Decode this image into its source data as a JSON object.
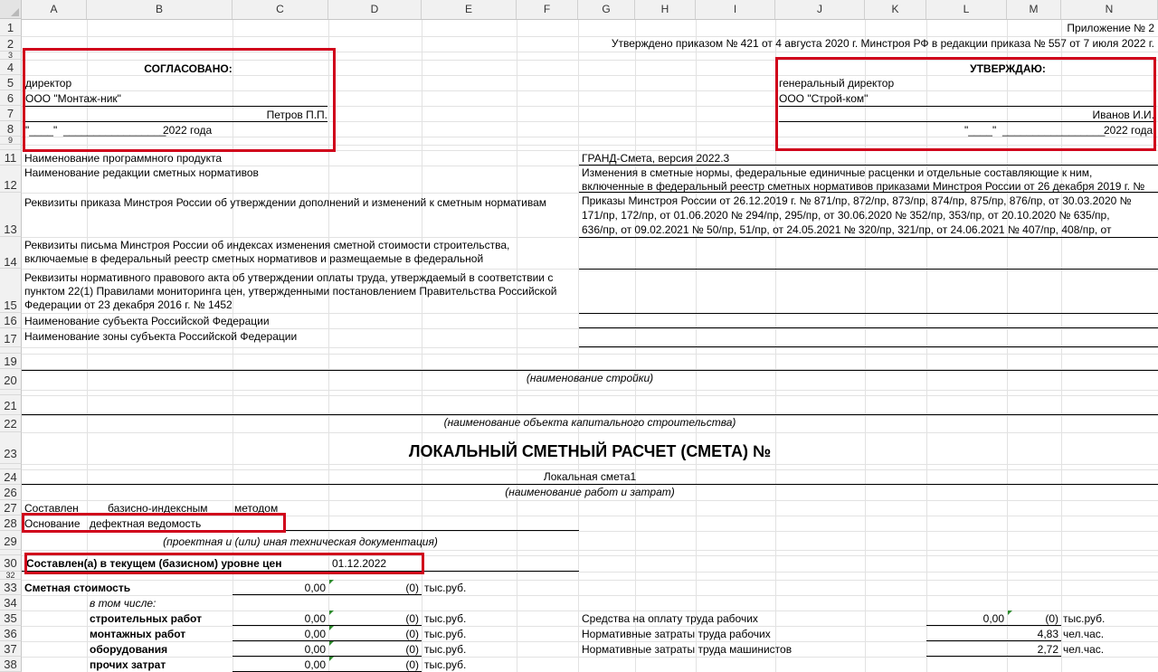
{
  "columns": [
    "A",
    "B",
    "C",
    "D",
    "E",
    "F",
    "G",
    "H",
    "I",
    "J",
    "K",
    "L",
    "M",
    "N"
  ],
  "rows": [
    "1",
    "2",
    "3",
    "4",
    "5",
    "6",
    "7",
    "8",
    "9",
    "11",
    "12",
    "13",
    "14",
    "15",
    "16",
    "17",
    "19",
    "20",
    "21",
    "22",
    "23",
    "24",
    "26",
    "27",
    "28",
    "29",
    "30",
    "32",
    "33",
    "34",
    "35",
    "36",
    "37",
    "38",
    "39"
  ],
  "header": {
    "appendix": "Приложение № 2",
    "approved_by_order": "Утверждено приказом № 421 от 4 августа 2020 г. Минстроя РФ в редакции приказа № 557 от 7 июля 2022 г."
  },
  "agreed": {
    "title": "СОГЛАСОВАНО:",
    "position": "директор",
    "company": "ООО \"Монтаж-ник\"",
    "name": "Петров П.П.",
    "date_quote": "\"____\"",
    "date_line": "_________________",
    "year": "2022 года"
  },
  "approve": {
    "title": "УТВЕРЖДАЮ:",
    "position": "генеральный директор",
    "company": "ООО \"Строй-ком\"",
    "name": "Иванов И.И.",
    "date_quote": "\"____\"",
    "date_line": "_________________",
    "year": "2022 года"
  },
  "info": {
    "program_label": "Наименование программного продукта",
    "program_value": "ГРАНД-Смета, версия 2022.3",
    "edition_label": "Наименование редакции сметных нормативов",
    "edition_value_1": "Изменения в сметные нормы, федеральные единичные расценки и отдельные составляющие к ним,",
    "edition_value_2": "включенные в федеральный реестр сметных нормативов приказами Минстроя России от 26 декабря 2019 г. №",
    "order_label": "Реквизиты приказа Минстроя России об утверждении дополнений и изменений к сметным нормативам",
    "order_value_1": "Приказы Минстроя России от 26.12.2019 г. № 871/пр, 872/пр, 873/пр, 874/пр, 875/пр, 876/пр, от 30.03.2020 №",
    "order_value_2": "171/пр, 172/пр, от 01.06.2020 № 294/пр, 295/пр, от 30.06.2020 № 352/пр, 353/пр, от 20.10.2020  № 635/пр,",
    "order_value_3": "636/пр, от 09.02.2021 № 50/пр, 51/пр, от 24.05.2021 № 320/пр, 321/пр, от 24.06.2021 № 407/пр, 408/пр, от",
    "letter_label_1": "Реквизиты письма Минстроя России об индексах изменения сметной стоимости строительства,",
    "letter_label_2": "включаемые в федеральный реестр сметных нормативов и размещаемые в федеральной",
    "act_label_1": "Реквизиты нормативного правового акта об утверждении оплаты труда, утверждаемый в соответствии с",
    "act_label_2": "пунктом 22(1) Правилами мониторинга цен, утвержденными постановлением Правительства Российской",
    "act_label_3": "Федерации от 23 декабря 2016 г. № 1452",
    "subject_label": "Наименование субъекта Российской Федерации",
    "zone_label": "Наименование зоны субъекта Российской Федерации"
  },
  "captions": {
    "construction": "(наименование стройки)",
    "object": "(наименование объекта капитального строительства)",
    "works": "(наименование работ и затрат)",
    "docs": "(проектная и (или) иная техническая документация)"
  },
  "title": "ЛОКАЛЬНЫЙ СМЕТНЫЙ РАСЧЕТ (СМЕТА) №",
  "estimate_name": "Локальная смета1",
  "method": {
    "label": "Составлен",
    "value": "базисно-индексным",
    "suffix": "методом"
  },
  "basis": {
    "label": "Основание",
    "value": "дефектная ведомость"
  },
  "price_level": {
    "label": "Составлен(а) в текущем (базисном) уровне цен",
    "value": "01.12.2022"
  },
  "cost": {
    "label": "Сметная стоимость",
    "value": "0,00",
    "paren": "(0)",
    "unit": "тыс.руб.",
    "including": "в том числе:",
    "items": [
      {
        "label": "строительных работ",
        "value": "0,00",
        "paren": "(0)",
        "unit": "тыс.руб."
      },
      {
        "label": "монтажных работ",
        "value": "0,00",
        "paren": "(0)",
        "unit": "тыс.руб."
      },
      {
        "label": "оборудования",
        "value": "0,00",
        "paren": "(0)",
        "unit": "тыс.руб."
      },
      {
        "label": "прочих затрат",
        "value": "0,00",
        "paren": "(0)",
        "unit": "тыс.руб."
      }
    ]
  },
  "labor": {
    "pay_label": "Средства на оплату труда рабочих",
    "pay_value": "0,00",
    "pay_paren": "(0)",
    "pay_unit": "тыс.руб.",
    "workers_label": "Нормативные затраты труда рабочих",
    "workers_value": "4,83",
    "workers_unit": "чел.час.",
    "machinists_label": "Нормативные затраты труда машинистов",
    "machinists_value": "2,72",
    "machinists_unit": "чел.час."
  },
  "colors": {
    "highlight": "#d0021b",
    "marker": "#2e8b2e",
    "header_bg": "#f1f1f1"
  }
}
